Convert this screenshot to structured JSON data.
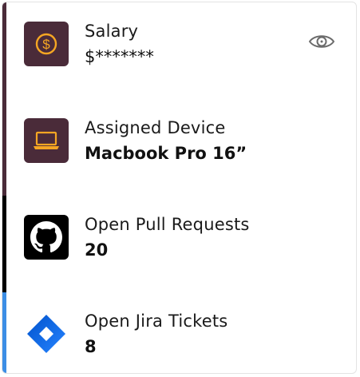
{
  "items": [
    {
      "label": "Salary",
      "value": "$*******",
      "icon": "dollar-icon",
      "accent": "#4a2b39",
      "icon_bg": "#4a2b39",
      "icon_fg": "#f5a623",
      "action_icon": "eye-icon"
    },
    {
      "label": "Assigned Device",
      "value": "Macbook Pro 16”",
      "icon": "laptop-icon",
      "accent": "#4a2b39",
      "icon_bg": "#4a2b39",
      "icon_fg": "#f5a623"
    },
    {
      "label": "Open Pull Requests",
      "value": "20",
      "icon": "github-icon",
      "accent": "#000000",
      "icon_bg": "#000000",
      "icon_fg": "#ffffff"
    },
    {
      "label": "Open Jira Tickets",
      "value": "8",
      "icon": "jira-icon",
      "accent": "#3c8ee5",
      "icon_bg": "#ffffff",
      "icon_fg": "#2684ff"
    }
  ]
}
